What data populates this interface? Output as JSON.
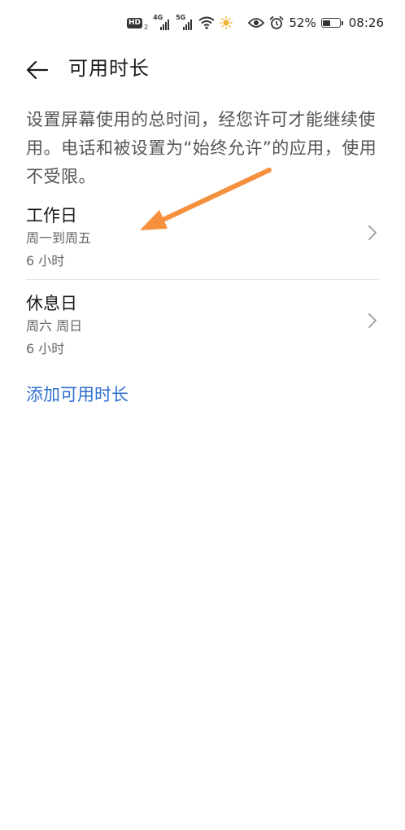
{
  "status_bar": {
    "hd_label": "HD",
    "hd_sub": "2",
    "sim1_tag": "4G",
    "sim2_tag": "5G",
    "battery_percent": "52%",
    "battery_level": 0.52,
    "time": "08:26",
    "icons": [
      "hd-icon",
      "signal-icon",
      "signal-icon",
      "wifi-icon",
      "sun-icon",
      "eye-icon",
      "alarm-icon",
      "battery-icon"
    ]
  },
  "header": {
    "title": "可用时长",
    "back_icon": "arrow-left-icon"
  },
  "description": "设置屏幕使用的总时间，经您许可才能继续使用。电话和被设置为“始终允许”的应用，使用不受限。",
  "items": [
    {
      "title": "工作日",
      "days": "周一到周五",
      "duration": "6 小时"
    },
    {
      "title": "休息日",
      "days": "周六 周日",
      "duration": "6 小时"
    }
  ],
  "add_label": "添加可用时长",
  "colors": {
    "accent": "#2f6fd0",
    "annotation_arrow": "#f5903d",
    "text_primary": "#1a1a1a",
    "text_secondary": "#666666"
  }
}
